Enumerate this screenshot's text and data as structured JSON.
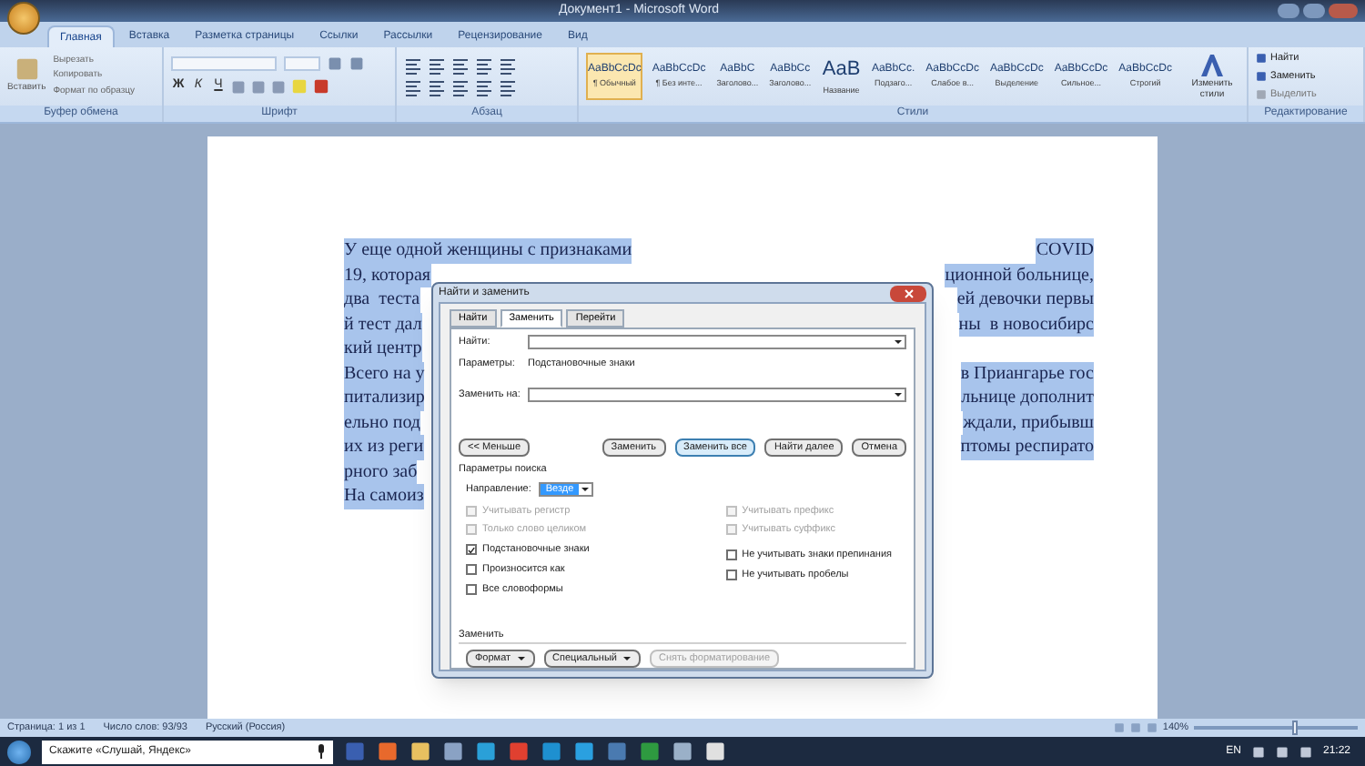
{
  "window": {
    "title": "Документ1 - Microsoft Word"
  },
  "ribbon_tabs": [
    {
      "label": "Главная",
      "selected": true
    },
    {
      "label": "Вставка",
      "selected": false
    },
    {
      "label": "Разметка страницы",
      "selected": false
    },
    {
      "label": "Ссылки",
      "selected": false
    },
    {
      "label": "Рассылки",
      "selected": false
    },
    {
      "label": "Рецензирование",
      "selected": false
    },
    {
      "label": "Вид",
      "selected": false
    }
  ],
  "clipboard": {
    "paste": "Вставить",
    "items": [
      "Вырезать",
      "Копировать",
      "Формат по образцу"
    ],
    "label": "Буфер обмена"
  },
  "font_group": {
    "buttons": [
      "Ж",
      "К",
      "Ч"
    ],
    "label": "Шрифт"
  },
  "paragraph_group": {
    "label": "Абзац"
  },
  "styles": {
    "label": "Стили",
    "items": [
      {
        "sample": "AaBbCcDc",
        "name": "¶ Обычный",
        "selected": true
      },
      {
        "sample": "AaBbCcDc",
        "name": "¶ Без инте...",
        "selected": false
      },
      {
        "sample": "AaBbC",
        "name": "Заголово...",
        "selected": false
      },
      {
        "sample": "AaBbCc",
        "name": "Заголово...",
        "selected": false
      },
      {
        "sample": "AaB",
        "name": "Название",
        "selected": false
      },
      {
        "sample": "AaBbCc.",
        "name": "Подзаго...",
        "selected": false
      },
      {
        "sample": "AaBbCcDc",
        "name": "Слабое в...",
        "selected": false
      },
      {
        "sample": "AaBbCcDc",
        "name": "Выделение",
        "selected": false
      },
      {
        "sample": "AaBbCcDc",
        "name": "Сильное...",
        "selected": false
      },
      {
        "sample": "AaBbCcDc",
        "name": "Строгий",
        "selected": false
      }
    ],
    "change": "Изменить стили"
  },
  "editing": {
    "label": "Редактирование",
    "items": [
      "Найти",
      "Заменить",
      "Выделить"
    ]
  },
  "document": {
    "lines": [
      {
        "left": "У еще одной женщины с признаками",
        "right": "COVID"
      },
      {
        "left": "19, которая",
        "right": "ционной больнице,"
      },
      {
        "left": "два  теста",
        "right": "ей девочки первы"
      },
      {
        "left": "й тест дал",
        "right": "ны  в новосибирс"
      },
      {
        "left": "кий центр"
      },
      {
        "left": "Всего на у",
        "right": "в Приангарье гос"
      },
      {
        "left": "питализир",
        "right": "льнице дополнит"
      },
      {
        "left": "ельно под",
        "right": "ждали, прибывш"
      },
      {
        "left": "их из реги",
        "right": "птомы респирато"
      },
      {
        "left": "рного заб"
      },
      {
        "left": "На самоиз"
      }
    ]
  },
  "dialog": {
    "title": "Найти и заменить",
    "tabs": [
      {
        "label": "Найти",
        "selected": false
      },
      {
        "label": "Заменить",
        "selected": true
      },
      {
        "label": "Перейти",
        "selected": false
      }
    ],
    "find_label": "Найти:",
    "options_label": "Параметры:",
    "options_value": "Подстановочные знаки",
    "replace_label": "Заменить на:",
    "buttons": [
      {
        "label": "<< Меньше",
        "focused": false
      },
      {
        "label": "Заменить",
        "focused": false
      },
      {
        "label": "Заменить все",
        "focused": true
      },
      {
        "label": "Найти далее",
        "focused": false
      },
      {
        "label": "Отмена",
        "focused": false
      }
    ],
    "search_options_label": "Параметры поиска",
    "direction_label": "Направление:",
    "direction_value": "Везде",
    "left_options": [
      {
        "label": "Учитывать регистр",
        "checked": false,
        "disabled": true
      },
      {
        "label": "Только слово целиком",
        "checked": false,
        "disabled": true
      },
      {
        "label": "Подстановочные знаки",
        "checked": true,
        "disabled": false
      },
      {
        "label": "Произносится как",
        "checked": false,
        "disabled": false
      },
      {
        "label": "Все словоформы",
        "checked": false,
        "disabled": false
      }
    ],
    "right_options": [
      {
        "label": "Учитывать префикс",
        "checked": false,
        "disabled": true
      },
      {
        "label": "Учитывать суффикс",
        "checked": false,
        "disabled": true
      },
      {
        "label": "Не учитывать знаки препинания",
        "checked": false,
        "disabled": false
      },
      {
        "label": "Не учитывать пробелы",
        "checked": false,
        "disabled": false
      }
    ],
    "replace_section_label": "Заменить",
    "bottom_buttons": [
      {
        "label": "Формат",
        "dropdown": true,
        "disabled": false
      },
      {
        "label": "Специальный",
        "dropdown": true,
        "disabled": false
      },
      {
        "label": "Снять форматирование",
        "dropdown": false,
        "disabled": true
      }
    ]
  },
  "status_bar": {
    "items": [
      "Страница: 1 из 1",
      "Число слов: 93/93",
      "Русский (Россия)"
    ],
    "zoom": "140%",
    "level": 0.6
  },
  "taskbar": {
    "search_placeholder": "Скажите «Слушай, Яндекс»",
    "language": "EN",
    "time": "21:22"
  }
}
